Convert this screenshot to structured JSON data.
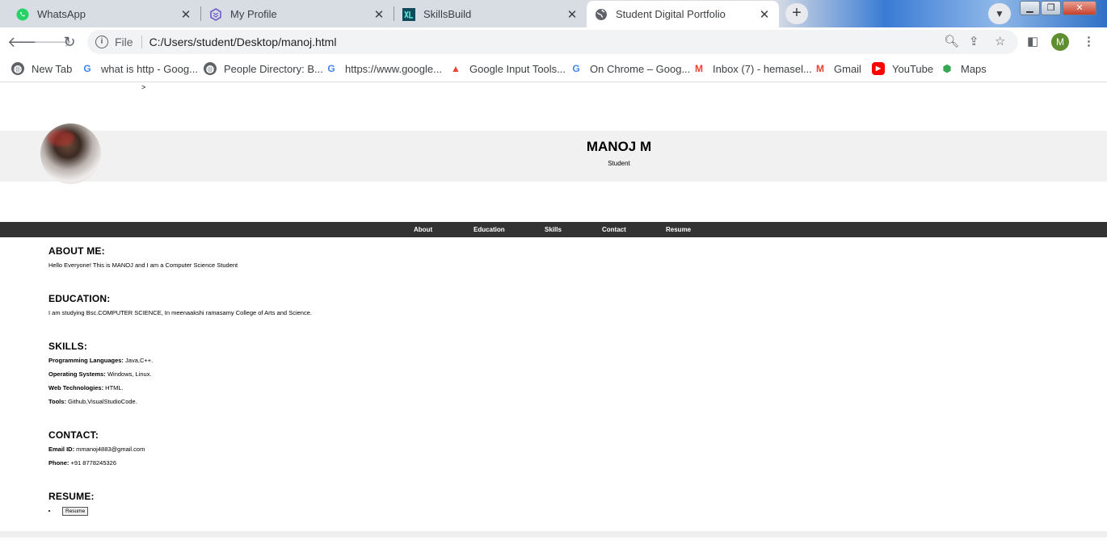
{
  "browser": {
    "tabs": [
      {
        "title": "WhatsApp",
        "icon": "whatsapp-icon"
      },
      {
        "title": "My Profile",
        "icon": "profile-icon"
      },
      {
        "title": "SkillsBuild",
        "icon": "skillsbuild-icon"
      },
      {
        "title": "Student Digital Portfolio",
        "icon": "globe-icon",
        "active": true
      }
    ],
    "address": {
      "scheme": "File",
      "url": "C:/Users/student/Desktop/manoj.html"
    },
    "profile_initial": "M",
    "bookmarks": [
      {
        "label": "New Tab",
        "icon": "globe-icon"
      },
      {
        "label": "what is http - Goog...",
        "icon": "google-icon"
      },
      {
        "label": "People Directory: B...",
        "icon": "globe-icon"
      },
      {
        "label": "https://www.google...",
        "icon": "google-icon"
      },
      {
        "label": "Google Input Tools...",
        "icon": "input-tools-icon"
      },
      {
        "label": "On Chrome – Goog...",
        "icon": "google-icon"
      },
      {
        "label": "Inbox (7) - hemasel...",
        "icon": "gmail-icon"
      },
      {
        "label": "Gmail",
        "icon": "gmail-icon"
      },
      {
        "label": "YouTube",
        "icon": "youtube-icon"
      },
      {
        "label": "Maps",
        "icon": "maps-icon"
      }
    ]
  },
  "page": {
    "caret": ">",
    "name": "MANOJ M",
    "role": "Student",
    "nav": [
      "About",
      "Education",
      "Skills",
      "Contact",
      "Resume"
    ],
    "about": {
      "heading": "ABOUT ME:",
      "text": "Hello Everyone! This is MANOJ and I am a Computer Science Student"
    },
    "education": {
      "heading": "EDUCATION:",
      "text": "I am studying Bsc.COMPUTER SCIENCE, In meenaakshi ramasamy College of Arts and Science."
    },
    "skills": {
      "heading": "SKILLS:",
      "items": [
        {
          "label": "Programming Languages:",
          "value": " Java,C++."
        },
        {
          "label": "Operating Systems:",
          "value": " Windows, Linux."
        },
        {
          "label": "Web Technologies:",
          "value": " HTML."
        },
        {
          "label": "Tools:",
          "value": " Github,VisualStudioCode."
        }
      ]
    },
    "contact": {
      "heading": "CONTACT:",
      "items": [
        {
          "label": "Email ID:",
          "value": " mmanoj4883@gmail.com"
        },
        {
          "label": "Phone:",
          "value": " +91 8778245326"
        }
      ]
    },
    "resume": {
      "heading": "RESUME:",
      "button": "Resume"
    }
  }
}
